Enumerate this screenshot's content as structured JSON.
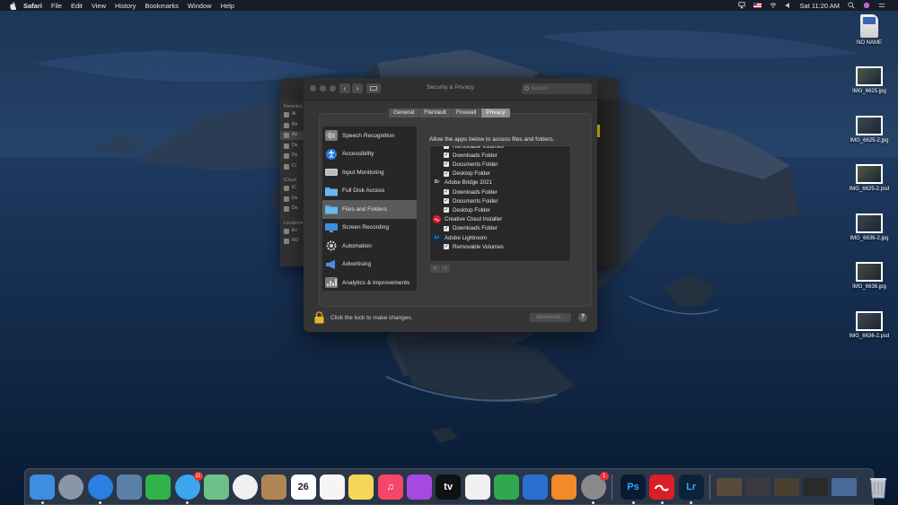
{
  "menubar": {
    "items": [
      "Safari",
      "File",
      "Edit",
      "View",
      "History",
      "Bookmarks",
      "Window",
      "Help"
    ],
    "clock": "Sat 11:20 AM"
  },
  "prefs": {
    "title": "Security & Privacy",
    "search_placeholder": "Search",
    "tabs": [
      "General",
      "FileVault",
      "Firewall",
      "Privacy"
    ],
    "active_tab": "Privacy",
    "categories": [
      {
        "label": "Speech Recognition",
        "icon": "waveform-icon"
      },
      {
        "label": "Accessibility",
        "icon": "accessibility-icon"
      },
      {
        "label": "Input Monitoring",
        "icon": "keyboard-icon"
      },
      {
        "label": "Full Disk Access",
        "icon": "folder-icon"
      },
      {
        "label": "Files and Folders",
        "icon": "folder-icon"
      },
      {
        "label": "Screen Recording",
        "icon": "display-icon"
      },
      {
        "label": "Automation",
        "icon": "gear-icon"
      },
      {
        "label": "Advertising",
        "icon": "megaphone-icon"
      },
      {
        "label": "Analytics & Improvements",
        "icon": "chart-icon"
      }
    ],
    "selected_category": "Files and Folders",
    "panel_label": "Allow the apps below to access files and folders.",
    "list": [
      {
        "type": "item",
        "label": "Removable Volumes",
        "checked": true
      },
      {
        "type": "item",
        "label": "Downloads Folder",
        "checked": true
      },
      {
        "type": "item",
        "label": "Documents Folder",
        "checked": true
      },
      {
        "type": "item",
        "label": "Desktop Folder",
        "checked": true
      },
      {
        "type": "app",
        "label": "Adobe Bridge 2021",
        "icon": "Br",
        "color": "#1f2a3a"
      },
      {
        "type": "item",
        "label": "Downloads Folder",
        "checked": true
      },
      {
        "type": "item",
        "label": "Documents Folder",
        "checked": true
      },
      {
        "type": "item",
        "label": "Desktop Folder",
        "checked": true
      },
      {
        "type": "app",
        "label": "Creative Cloud Installer",
        "icon": "cc",
        "color": "#da1f26"
      },
      {
        "type": "item",
        "label": "Downloads Folder",
        "checked": true
      },
      {
        "type": "app",
        "label": "Adobe Lightroom",
        "icon": "Lr",
        "color": "#0c2f4e"
      },
      {
        "type": "item",
        "label": "Removable Volumes",
        "checked": true
      }
    ],
    "plus": "+",
    "minus": "−",
    "check_mark": "✓",
    "lock_text": "Click the lock to make changes.",
    "advanced_label": "Advanced...",
    "help_label": "?"
  },
  "finder": {
    "sections": [
      {
        "label": "Favorites",
        "items": [
          "Ai",
          "Re",
          "Ap",
          "De",
          "Do",
          "Cr"
        ]
      },
      {
        "label": "iCloud",
        "items": [
          "iC",
          "Do",
          "De"
        ]
      },
      {
        "label": "Locations",
        "items": [
          "Ev",
          "NO"
        ]
      }
    ]
  },
  "desktop": {
    "icons": [
      {
        "label": "NO NAME",
        "kind": "sdcard"
      },
      {
        "label": "IMG_6625.jpg",
        "kind": "photo"
      },
      {
        "label": "IMG_6625-2.jpg",
        "kind": "photo"
      },
      {
        "label": "IMG_6625-2.psd",
        "kind": "photo"
      },
      {
        "label": "IMG_6636-2.jpg",
        "kind": "photo"
      },
      {
        "label": "IMG_6636.jpg",
        "kind": "photo"
      },
      {
        "label": "IMG_6636-2.psd",
        "kind": "photo"
      }
    ]
  },
  "dock": {
    "apps": [
      {
        "name": "finder-app",
        "color": "#3d8de0",
        "glyph": "",
        "dot": true
      },
      {
        "name": "launchpad-app",
        "color": "#8a96a8",
        "glyph": "",
        "dot": false
      },
      {
        "name": "safari-app",
        "color": "#2a7fe0",
        "glyph": "",
        "dot": true
      },
      {
        "name": "preview-app",
        "color": "#5a7fa8",
        "glyph": "",
        "dot": false
      },
      {
        "name": "facetime-app",
        "color": "#31b34a",
        "glyph": "",
        "dot": false
      },
      {
        "name": "messages-app",
        "color": "#3aa6f0",
        "glyph": "",
        "dot": true,
        "badge": "11"
      },
      {
        "name": "maps-app",
        "color": "#6cc08a",
        "glyph": "",
        "dot": false
      },
      {
        "name": "photos-app",
        "color": "#f0f0f0",
        "glyph": "",
        "dot": false
      },
      {
        "name": "contacts-app",
        "color": "#b08656",
        "glyph": "",
        "dot": false
      },
      {
        "name": "calendar-app",
        "color": "#ffffff",
        "glyph": "26",
        "glyph_color": "#222",
        "dot": false
      },
      {
        "name": "reminders-app",
        "color": "#f5f5f5",
        "glyph": "",
        "dot": false
      },
      {
        "name": "notes-app",
        "color": "#f6d65a",
        "glyph": "",
        "dot": false
      },
      {
        "name": "music-app",
        "color": "#f5466a",
        "glyph": "♫",
        "dot": false
      },
      {
        "name": "podcasts-app",
        "color": "#a44ae0",
        "glyph": "",
        "dot": false
      },
      {
        "name": "tv-app",
        "color": "#111111",
        "glyph": "tv",
        "dot": false
      },
      {
        "name": "news-app",
        "color": "#f0f0f0",
        "glyph": "",
        "dot": false
      },
      {
        "name": "numbers-app",
        "color": "#2fa84f",
        "glyph": "",
        "dot": false
      },
      {
        "name": "keynote-app",
        "color": "#2a6fd0",
        "glyph": "",
        "dot": false
      },
      {
        "name": "pages-app",
        "color": "#f08a2a",
        "glyph": "",
        "dot": false
      },
      {
        "name": "system-preferences-app",
        "color": "#8a8a8a",
        "glyph": "",
        "dot": true,
        "badge": "1"
      },
      {
        "name": "photoshop-app",
        "color": "#0a1a33",
        "glyph": "Ps",
        "glyph_color": "#31a8ff",
        "dot": true
      },
      {
        "name": "creative-cloud-app",
        "color": "#da1f26",
        "glyph": "",
        "dot": true
      },
      {
        "name": "lightroom-app",
        "color": "#0c2238",
        "glyph": "Lr",
        "glyph_color": "#31a8ff",
        "dot": true
      }
    ],
    "thumbs": [
      "#5a4a3a",
      "#3a3a40",
      "#4a4030",
      "#2a2a2a",
      "#4a6a9a"
    ]
  }
}
